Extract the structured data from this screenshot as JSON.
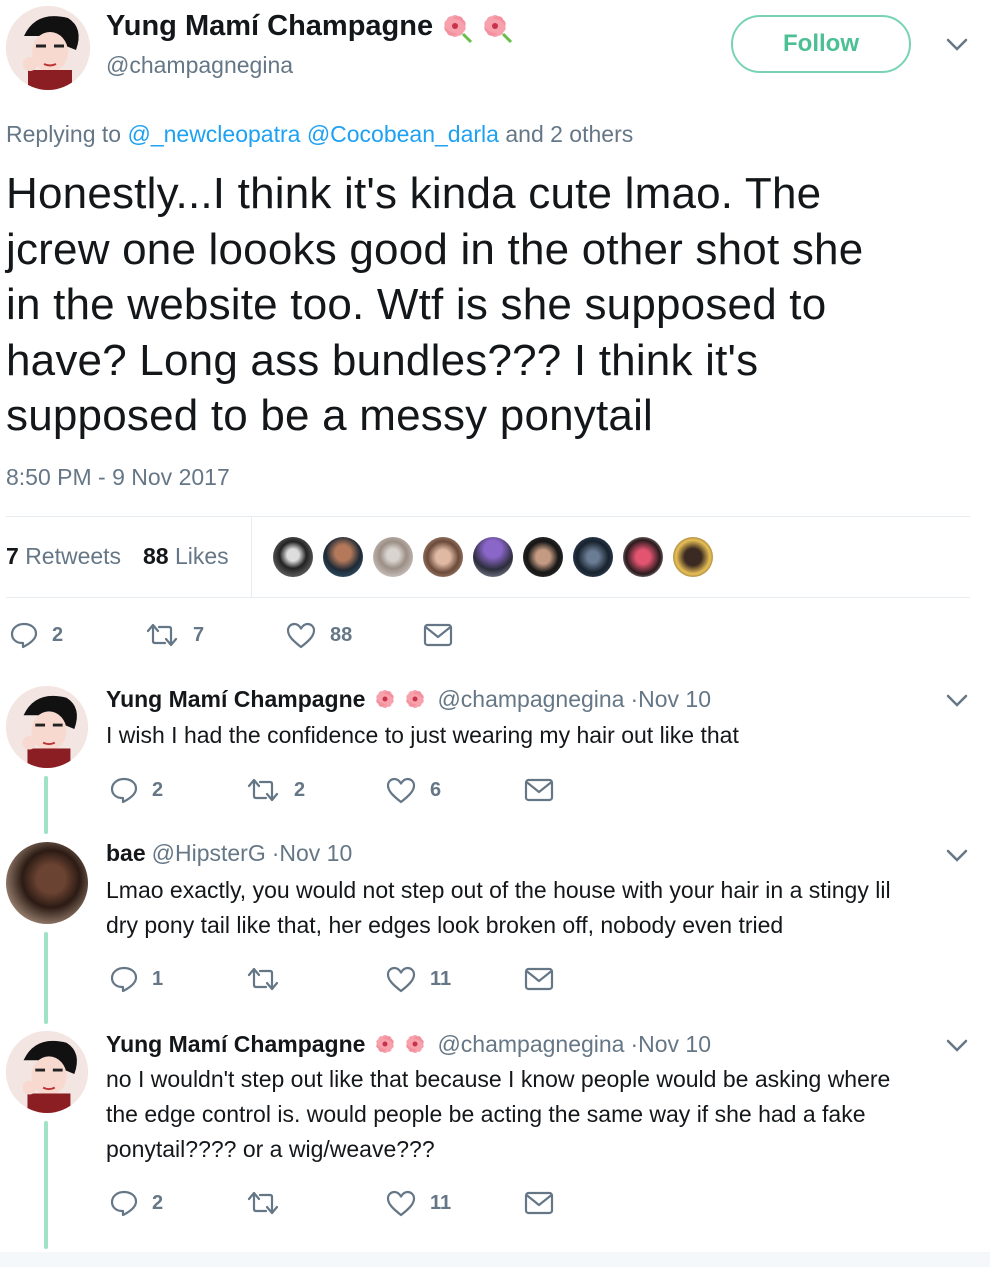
{
  "tweet": {
    "author_name": "Yung Mamí Champagne",
    "author_handle": "@champagnegina",
    "follow_label": "Follow",
    "replying_prefix": "Replying to",
    "replying_mention_1": "@_newcleopatra",
    "replying_mention_2": "@Cocobean_darla",
    "replying_suffix": "and 2 others",
    "text_lines": [
      "Honestly...I think it's kinda cute lmao. The",
      "jcrew one loooks good in the other shot she",
      "in the website too. Wtf is she supposed to",
      "have?  Long ass bundles??? I think it's",
      "supposed to be a messy ponytail"
    ],
    "timestamp": "8:50 PM - 9 Nov 2017",
    "retweets_count": "7",
    "retweets_label": "Retweets",
    "likes_count": "88",
    "likes_label": "Likes",
    "actions": {
      "reply": "2",
      "retweet": "7",
      "like": "88"
    }
  },
  "replies": [
    {
      "name": "Yung Mamí Champagne",
      "handle": "@champagnegina",
      "time": "·Nov 10",
      "lines": [
        "I wish I had the confidence to just wearing my hair out like that"
      ],
      "reply": "2",
      "retweet": "2",
      "like": "6"
    },
    {
      "name": "bae",
      "handle": "@HipsterG",
      "time": "·Nov 10",
      "lines": [
        "Lmao exactly, you would not step out of the house with your hair in a stingy lil",
        "dry pony tail like that, her edges look broken off, nobody even tried"
      ],
      "reply": "1",
      "retweet": "",
      "like": "11"
    },
    {
      "name": "Yung Mamí Champagne",
      "handle": "@champagnegina",
      "time": "·Nov 10",
      "lines": [
        "no I wouldn't step out like that because I know people would be asking where",
        "the edge control is. would people be acting the same way if she had a fake",
        "ponytail???? or a wig/weave???"
      ],
      "reply": "2",
      "retweet": "",
      "like": "11"
    }
  ],
  "icons": {
    "reply": "reply-icon",
    "retweet": "retweet-icon",
    "like": "heart-icon",
    "dm": "envelope-icon",
    "more": "chevron-down-icon",
    "emoji": "hibiscus-icon"
  },
  "colors": {
    "link": "#1da1f2",
    "muted": "#657786",
    "follow": "#4dbf95",
    "thread": "#9fe2c5"
  }
}
